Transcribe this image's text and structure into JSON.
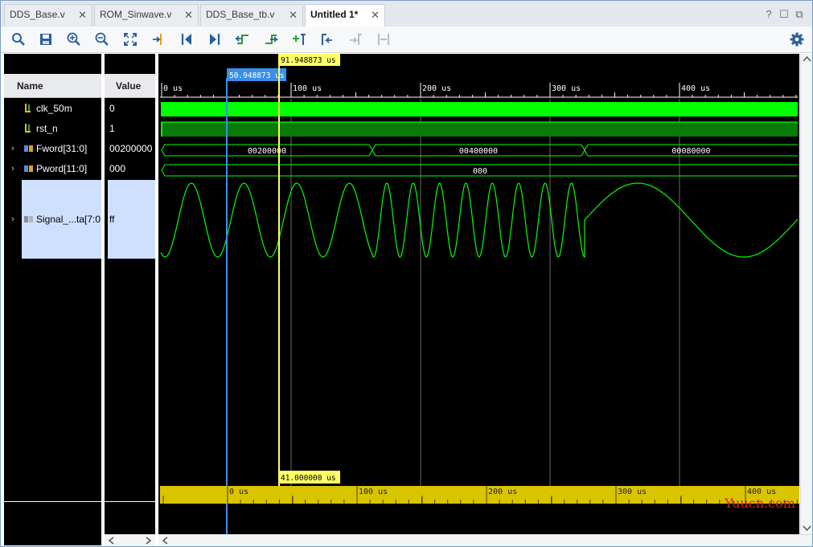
{
  "tabs": [
    {
      "label": "DDS_Base.v"
    },
    {
      "label": "ROM_Sinwave.v"
    },
    {
      "label": "DDS_Base_tb.v"
    },
    {
      "label": "Untitled 1*"
    }
  ],
  "tab_close_glyph": "✕",
  "window_controls": {
    "help": "?",
    "restore": "☐",
    "float": "⧉"
  },
  "toolbar_icons": [
    "search-icon",
    "save-icon",
    "zoom-in-icon",
    "zoom-out-icon",
    "zoom-fit-icon",
    "go-to-cursor-icon",
    "go-to-start-icon",
    "go-to-end-icon",
    "previous-transition-icon",
    "next-transition-icon",
    "add-marker-icon",
    "previous-marker-icon",
    "next-marker-icon",
    "swap-cursors-icon",
    "settings-icon"
  ],
  "columns": {
    "name": "Name",
    "value": "Value"
  },
  "signals": [
    {
      "name": "clk_50m",
      "value": "0",
      "expandable": false,
      "kind": "bit"
    },
    {
      "name": "rst_n",
      "value": "1",
      "expandable": false,
      "kind": "bit"
    },
    {
      "name": "Fword[31:0]",
      "value": "00200000",
      "expandable": true,
      "kind": "bus"
    },
    {
      "name": "Pword[11:0]",
      "value": "000",
      "expandable": true,
      "kind": "bus"
    },
    {
      "name": "Signal_...ta[7:0",
      "value": "ff",
      "expandable": true,
      "kind": "analog"
    }
  ],
  "fword_segments": [
    "00200000",
    "00400000",
    "00080000"
  ],
  "pword_segments": [
    "000"
  ],
  "time_ruler": {
    "ticks": [
      "0 us",
      "100 us",
      "200 us",
      "300 us",
      "400 us"
    ]
  },
  "cursors": {
    "main": "91.948873 us",
    "secondary": "50.948873 us",
    "delta": "41.000000 us"
  },
  "colors": {
    "wave": "#00ff00",
    "wave_dim": "#0a7a0a",
    "cursor_main": "#ffff55",
    "cursor_secondary": "#3b8fe8",
    "delta_bar": "#d9c400",
    "selection": "#cfe0ff"
  },
  "watermark": "Yuucn.com"
}
